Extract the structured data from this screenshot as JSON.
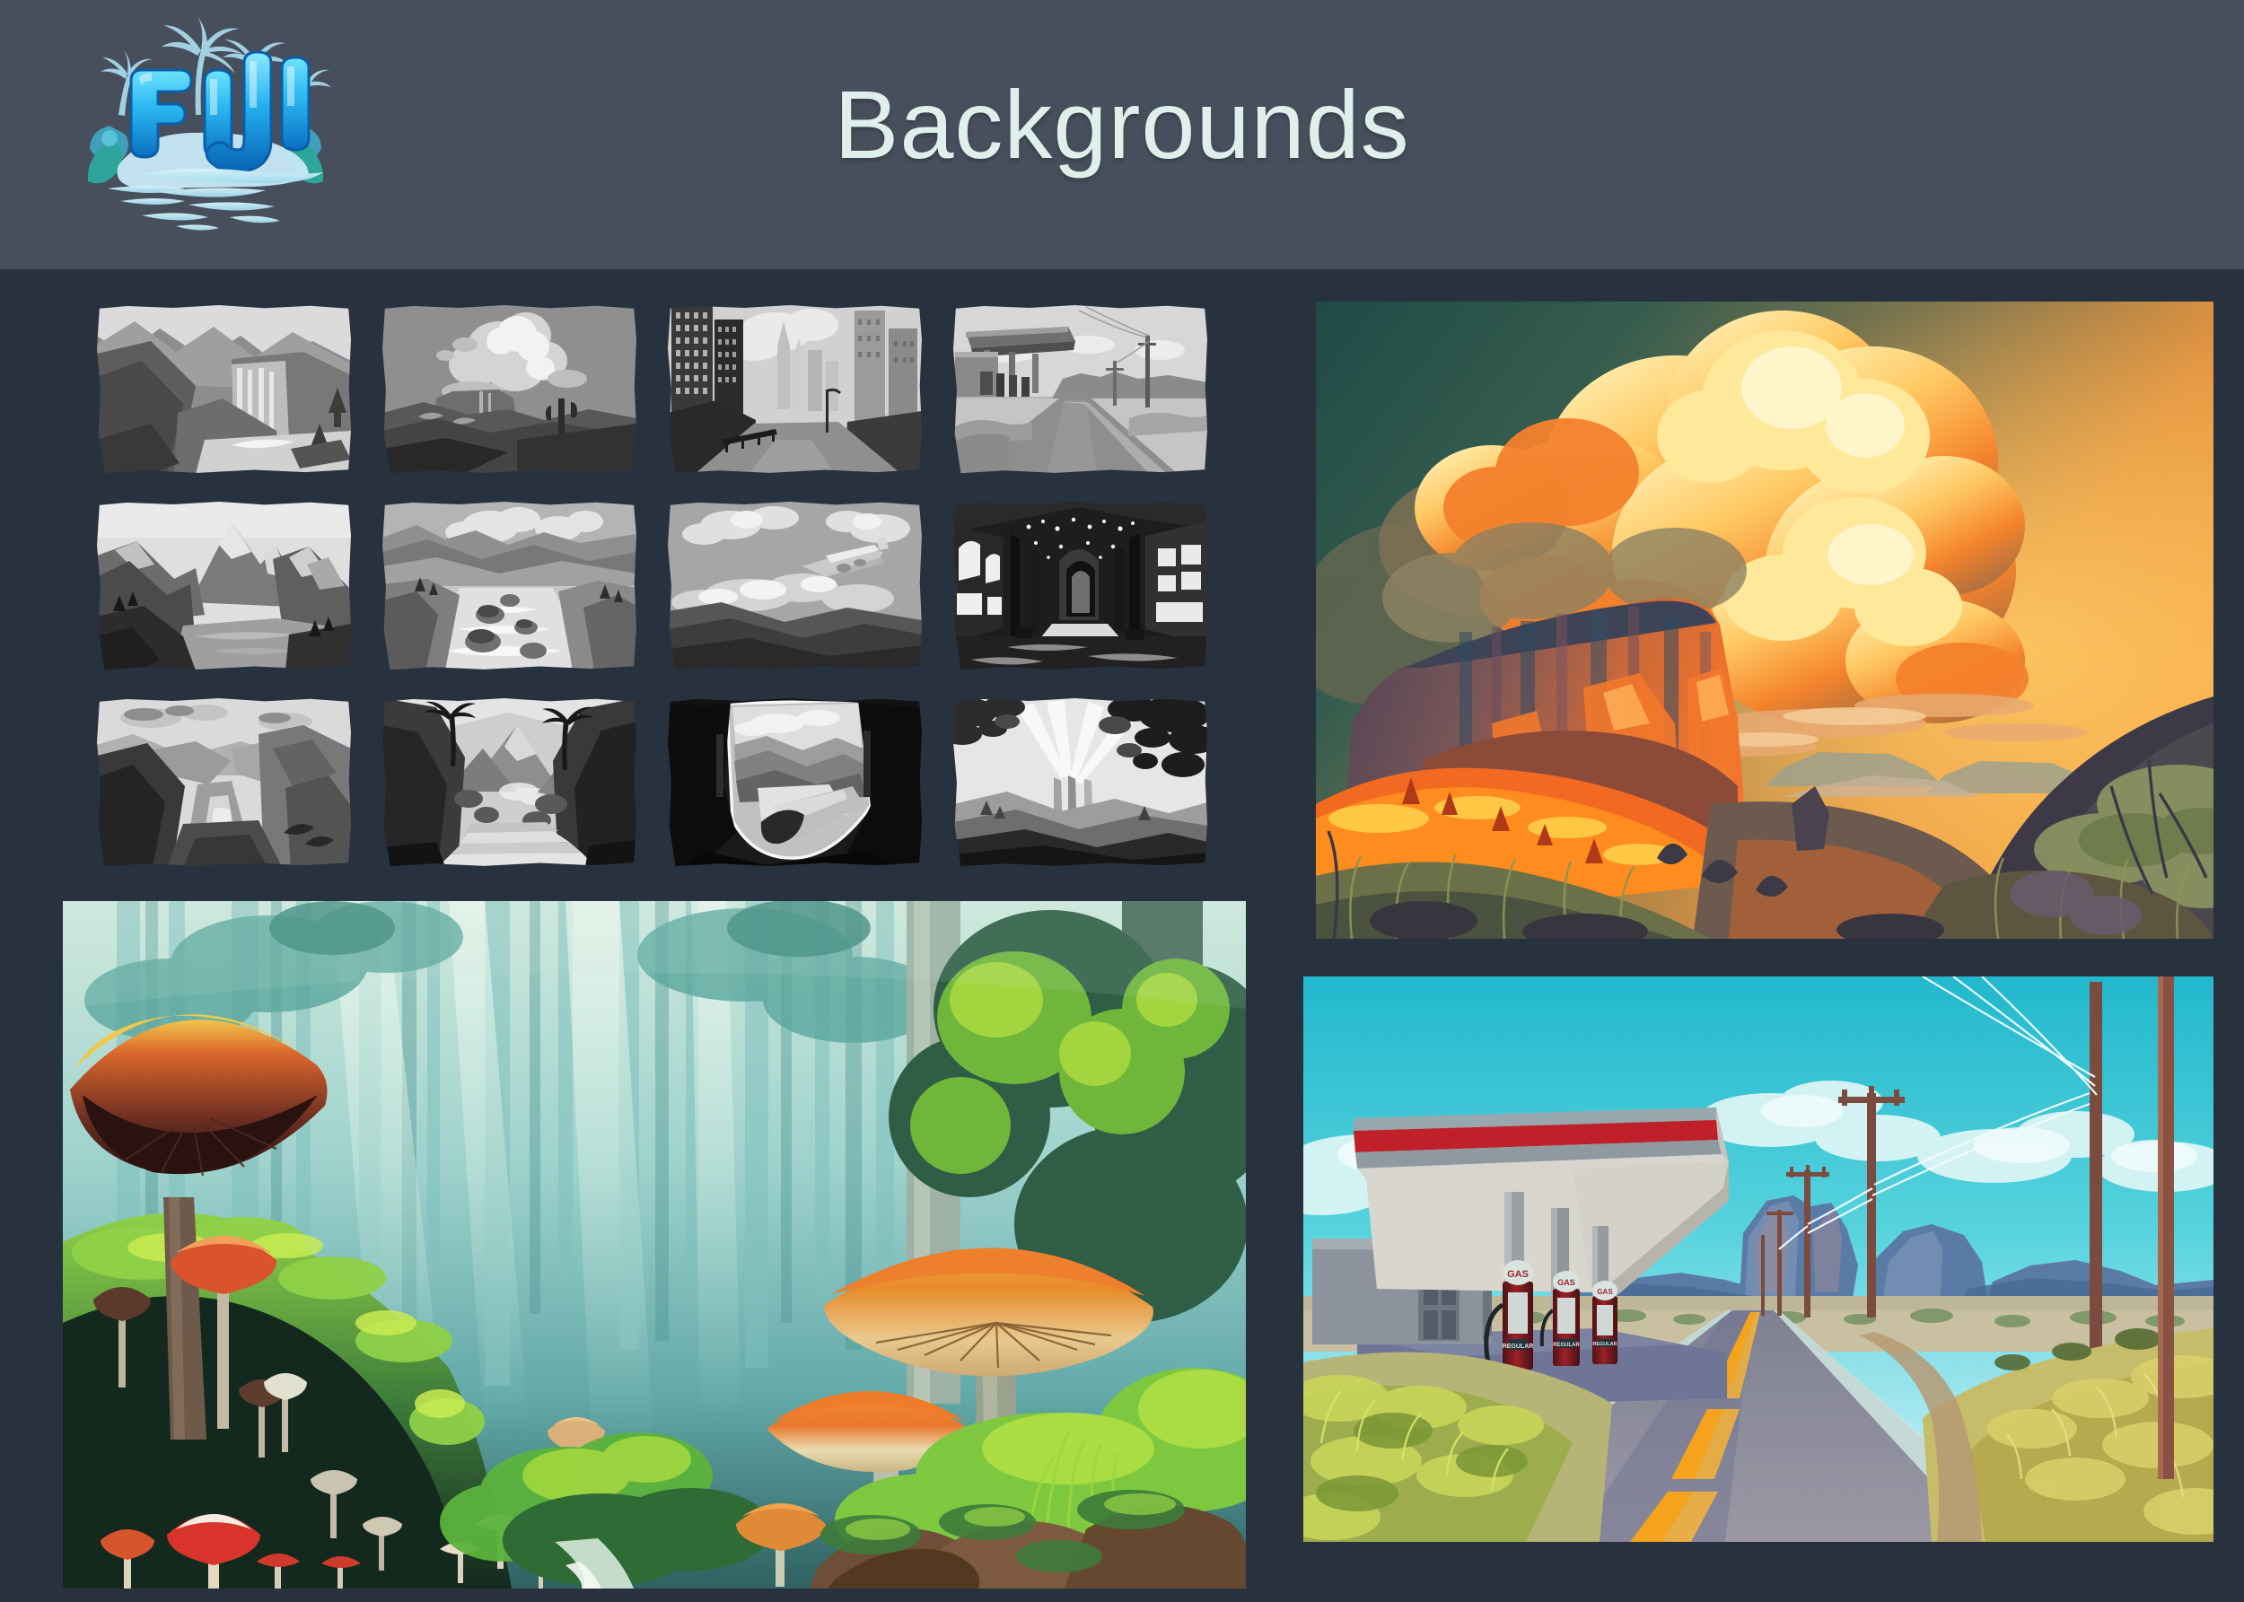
{
  "header": {
    "title": "Backgrounds",
    "logo": {
      "name": "fiji-logo",
      "wordmark": "FIJI",
      "motifs": [
        "palm-tree",
        "hibiscus-flower",
        "water-wave",
        "island"
      ],
      "colors": {
        "letter_light": "#56d6f7",
        "letter_mid": "#1aa7e8",
        "letter_dark": "#0b74c4",
        "foliage": "#9fd8e8",
        "water": "#bdeaf4",
        "island": "#c9e7f2"
      }
    },
    "colors": {
      "band": "#474f5c",
      "title_text": "#dff0ec"
    }
  },
  "page": {
    "background": "#28323f"
  },
  "thumbnail_grid": {
    "name": "grayscale-thumbnail-studies",
    "columns": 4,
    "rows": 3,
    "style": "grayscale value sketches",
    "items": [
      {
        "id": "t1",
        "label": "Canyon waterfall with snowy peaks",
        "tone": "mid-gray"
      },
      {
        "id": "t2",
        "label": "Desert mesa with towering cumulus cloud and cactus",
        "tone": "light-gray"
      },
      {
        "id": "t3",
        "label": "City street with skyscrapers and overpass",
        "tone": "high-contrast"
      },
      {
        "id": "t4",
        "label": "Roadside gas station with canopy and power lines",
        "tone": "light-gray"
      },
      {
        "id": "t5",
        "label": "Fjord valley with sharp mountain peaks and lake",
        "tone": "dark-gray"
      },
      {
        "id": "t6",
        "label": "Wide river rapids flowing toward distant mountains",
        "tone": "mid-gray"
      },
      {
        "id": "t7",
        "label": "Airplane banking above a cloud bank",
        "tone": "mid-gray"
      },
      {
        "id": "t8",
        "label": "Interior of a ruined cathedral nave with arched windows",
        "tone": "dark / night"
      },
      {
        "id": "t9",
        "label": "Deep canyon gorge with winding river below",
        "tone": "light-gray"
      },
      {
        "id": "t10",
        "label": "Jungle ravine with palms and stone steps",
        "tone": "dark-gray"
      },
      {
        "id": "t11",
        "label": "View through a broken aircraft fuselage onto a valley",
        "tone": "high-contrast"
      },
      {
        "id": "t12",
        "label": "Forest clearing seen from below with sunbeams and foliage",
        "tone": "light-gray"
      }
    ]
  },
  "panels": [
    {
      "id": "panel-forest",
      "name": "forest-mushrooms-painting",
      "title": "Misty forest with giant mushrooms",
      "palette": {
        "mist": "#cfe9e2",
        "canopy_teal": "#63b0ab",
        "deep_teal": "#2d6b6a",
        "moss_green": "#7dc24a",
        "dark_moss": "#1e3327",
        "cap_orange": "#e89a3c",
        "cap_red": "#d4442c",
        "gill_cream": "#f0d9a8",
        "stem_gray": "#9aa390",
        "rock_brown": "#7a5338"
      },
      "elements": [
        "giant mushroom caps",
        "mossy hillside",
        "light shafts",
        "tall tree trunks",
        "rock cluster",
        "small red mushrooms",
        "ferns and grasses"
      ]
    },
    {
      "id": "panel-desert",
      "name": "desert-mesa-sunset-painting",
      "title": "Sunset mesa with glowing cumulus cloud",
      "palette": {
        "sky_teal": "#2d5a52",
        "sky_amber": "#e6913f",
        "cloud_bright": "#ffdb7a",
        "cloud_orange": "#f98b2c",
        "cloud_shadow": "#6d6a58",
        "mesa_purple": "#6b4f63",
        "mesa_lit": "#f2712c",
        "scrub_olive": "#8d9158",
        "foreground_dark": "#4a4352"
      },
      "elements": [
        "towering cumulus cloud",
        "flat-topped mesa",
        "glowing rim light",
        "distant buttes",
        "scrub grass foreground",
        "silhouetted shrubs"
      ]
    },
    {
      "id": "panel-gas",
      "name": "highway-gas-station-painting",
      "title": "Desert highway gas station under blue sky",
      "palette": {
        "sky_cyan": "#37c6d4",
        "sky_pale": "#b9e9ee",
        "cloud_white": "#e8f7f8",
        "canopy_red": "#c0242d",
        "canopy_gray": "#c9c6c2",
        "pump_red": "#8e1f22",
        "road_gray": "#8e8d99",
        "road_dark": "#5c5b78",
        "centerline_yellow": "#f5a11c",
        "grass_gold": "#c6bb55",
        "grass_green": "#98ba45",
        "mesa_blue": "#52709b",
        "pole_brown": "#7d4a3f"
      },
      "signage": {
        "pump_top_sign": "GAS",
        "pump_body_label": "REGULAR"
      },
      "elements": [
        "service station canopy",
        "three vintage fuel pumps",
        "concrete store building",
        "two-lane highway with yellow centerline",
        "utility poles with wires",
        "distant mesas",
        "roadside grass"
      ]
    }
  ]
}
